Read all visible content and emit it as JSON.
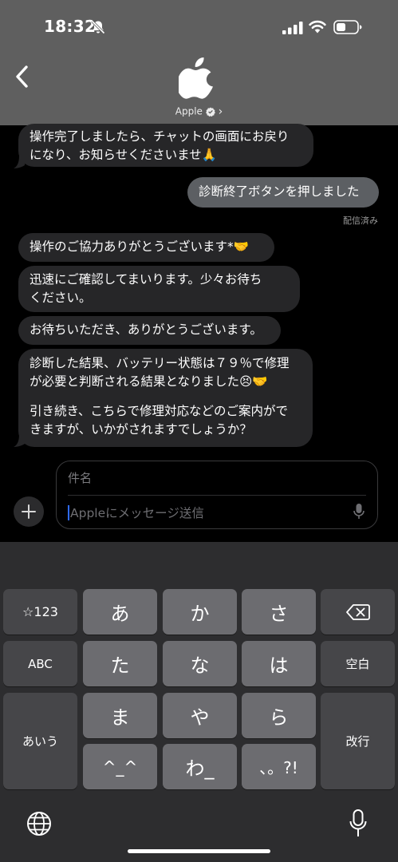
{
  "status": {
    "time": "18:32"
  },
  "header": {
    "contact_name": "Apple",
    "chevron": "›"
  },
  "messages": [
    {
      "direction": "in",
      "lines": [
        "操作完了しましたら、チャットの画面にお戻り",
        "になり、お知らせくださいませ🙏"
      ]
    },
    {
      "direction": "out",
      "lines": [
        "診断終了ボタンを押しました"
      ]
    },
    {
      "direction": "in",
      "lines": [
        "操作のご協力ありがとうございます*🤝"
      ]
    },
    {
      "direction": "in",
      "lines": [
        "迅速にご確認してまいります。少々お待ち",
        "ください。"
      ]
    },
    {
      "direction": "in",
      "lines": [
        "お待ちいただき、ありがとうございます。"
      ]
    },
    {
      "direction": "in",
      "lines": [
        "診断した結果、バッテリー状態は７９％で修理",
        "が必要と判断される結果となりました😣🤝",
        "",
        "引き続き、こちらで修理対応などのご案内がで",
        "きますが、いかがされますでしょうか？"
      ]
    }
  ],
  "delivered_label": "配信済み",
  "compose": {
    "subject_placeholder": "件名",
    "message_placeholder": "Appleにメッセージ送信",
    "plus_label": "+"
  },
  "keyboard": {
    "row1": [
      "☆123",
      "あ",
      "か",
      "さ"
    ],
    "row2": [
      "ABC",
      "た",
      "な",
      "は",
      "空白"
    ],
    "row3": [
      "あいう",
      "ま",
      "や",
      "ら",
      "改行"
    ],
    "row4": [
      "^_^",
      "わ_",
      "、。?!"
    ],
    "icons": {
      "delete": "delete-icon",
      "globe": "globe-icon",
      "mic": "mic-icon"
    }
  }
}
